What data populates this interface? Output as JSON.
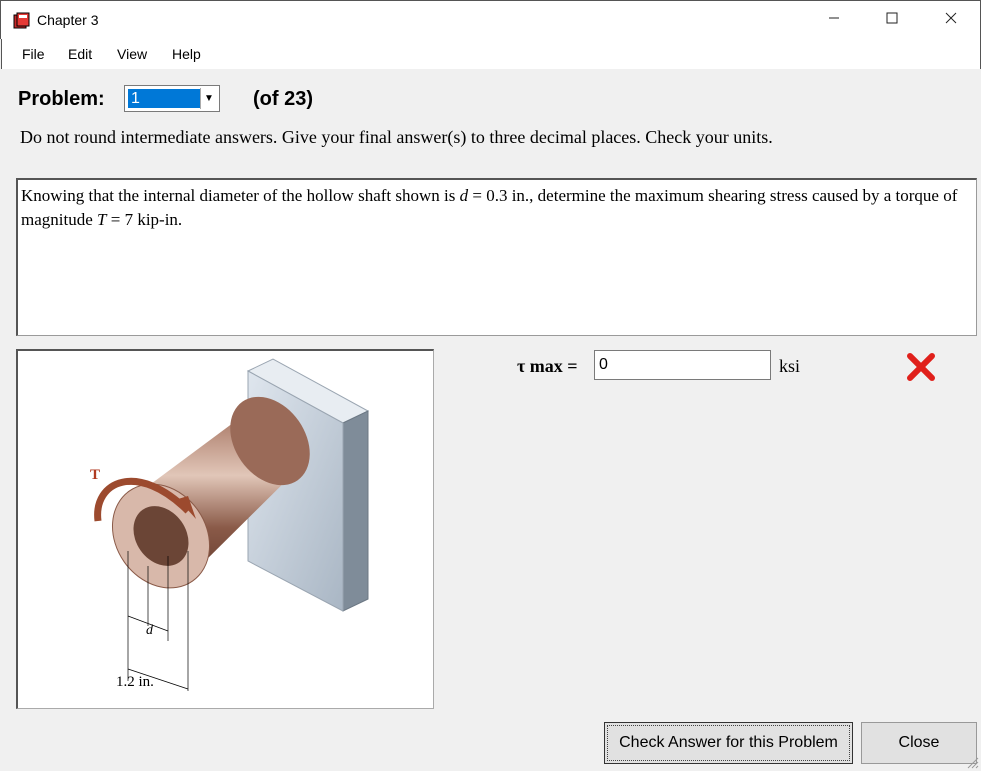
{
  "window": {
    "title": "Chapter 3"
  },
  "menu": [
    "File",
    "Edit",
    "View",
    "Help"
  ],
  "problem": {
    "label": "Problem:",
    "selected": "1",
    "count": "(of 23)"
  },
  "instructions": "Do not round intermediate answers.  Give your final answer(s) to three decimal places.  Check your units.",
  "problem_text": {
    "part1": "Knowing that the internal diameter of the hollow shaft shown is ",
    "var_d": "d",
    "part2": " = 0.3 in., determine the maximum shearing stress caused by a torque of magnitude ",
    "var_T": "T",
    "part3": " = 7 kip-in."
  },
  "figure": {
    "torque_label": "T",
    "d_label": "d",
    "dim_label": "1.2 in."
  },
  "answer": {
    "label": "τ max =",
    "value": "0",
    "unit": "ksi",
    "status_icon": "red-x-icon"
  },
  "buttons": {
    "check": "Check Answer for this Problem",
    "close": "Close"
  },
  "colors": {
    "selection": "#0078d7",
    "wrong": "#e0201b",
    "shaft": "#8a5a48"
  }
}
